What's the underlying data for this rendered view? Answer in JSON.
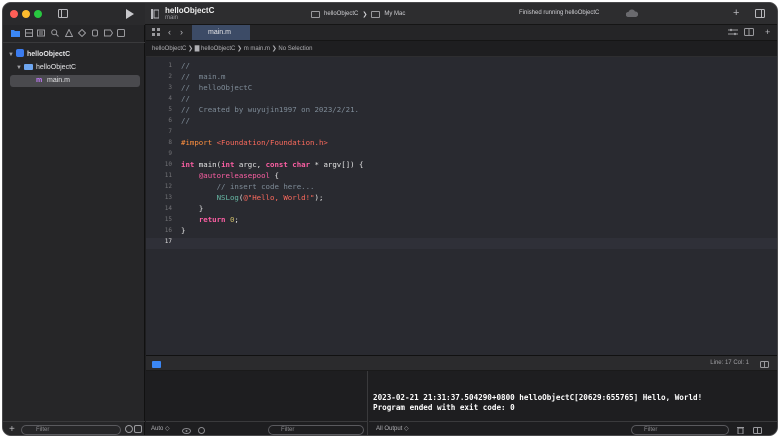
{
  "window": {
    "project_title": "helloObjectC",
    "project_subtitle": "main",
    "scheme_target": "helloObjectC",
    "scheme_separator": "❯",
    "scheme_destination": "My Mac",
    "status": "Finished running helloObjectC"
  },
  "navigator": {
    "project": "helloObjectC",
    "group": "helloObjectC",
    "file": "main.m",
    "filter_placeholder": "Filter"
  },
  "editor": {
    "tab_label": "main.m",
    "jump_bar": "helloObjectC ❯ ▇ helloObjectC ❯ m main.m ❯ No Selection",
    "cursor_status": "Line: 17  Col: 1",
    "line_numbers": [
      "1",
      "2",
      "3",
      "4",
      "5",
      "6",
      "7",
      "8",
      "9",
      "10",
      "11",
      "12",
      "13",
      "14",
      "15",
      "16",
      "17"
    ],
    "code": {
      "l1": "//",
      "l2": "//  main.m",
      "l3": "//  helloObjectC",
      "l4": "//",
      "l5": "//  Created by wuyujin1997 on 2023/2/21.",
      "l6": "//",
      "l8_directive": "#import",
      "l8_header": "<Foundation/Foundation.h>",
      "l10_int": "int",
      "l10_main": " main(",
      "l10_int2": "int",
      "l10_argc": " argc, ",
      "l10_const": "const",
      "l10_sp": " ",
      "l10_char": "char",
      "l10_rest": " * argv[]) {",
      "l11_pool": "@autoreleasepool",
      "l11_rest": " {",
      "l12": "// insert code here...",
      "l13_fn": "NSLog",
      "l13_open": "(",
      "l13_str": "@\"Hello, World!\"",
      "l13_close": ");",
      "l14": "}",
      "l15_ret": "return",
      "l15_sp": " ",
      "l15_num": "0",
      "l15_semi": ";",
      "l16": "}"
    }
  },
  "debug": {
    "variables_scope": "Auto ◇",
    "variables_filter": "Filter",
    "console_scope": "All Output ◇",
    "console_filter": "Filter",
    "console_lines": "2023-02-21 21:31:37.504290+0800 helloObjectC[20629:655765] Hello, World!\nProgram ended with exit code: 0"
  },
  "colors": {
    "accent": "#3b87f5",
    "editor_bg": "#292a30",
    "comment": "#7f8c98",
    "keyword": "#fc5fa3",
    "string": "#fc6a5d",
    "preprocessor": "#fd8f3f",
    "function": "#67b7a4",
    "number": "#d0bf69"
  },
  "icons": [
    "sidebar-toggle-icon",
    "run-icon",
    "stop-icon",
    "app-icon",
    "mac-icon",
    "cloud-icon",
    "plus-icon",
    "split-layout-icon",
    "chevron-left-icon",
    "chevron-right-icon",
    "folder-icon",
    "search-icon",
    "warning-icon",
    "test-icon",
    "debug-icon",
    "breakpoint-icon",
    "report-icon",
    "filter-icon",
    "trash-icon"
  ]
}
